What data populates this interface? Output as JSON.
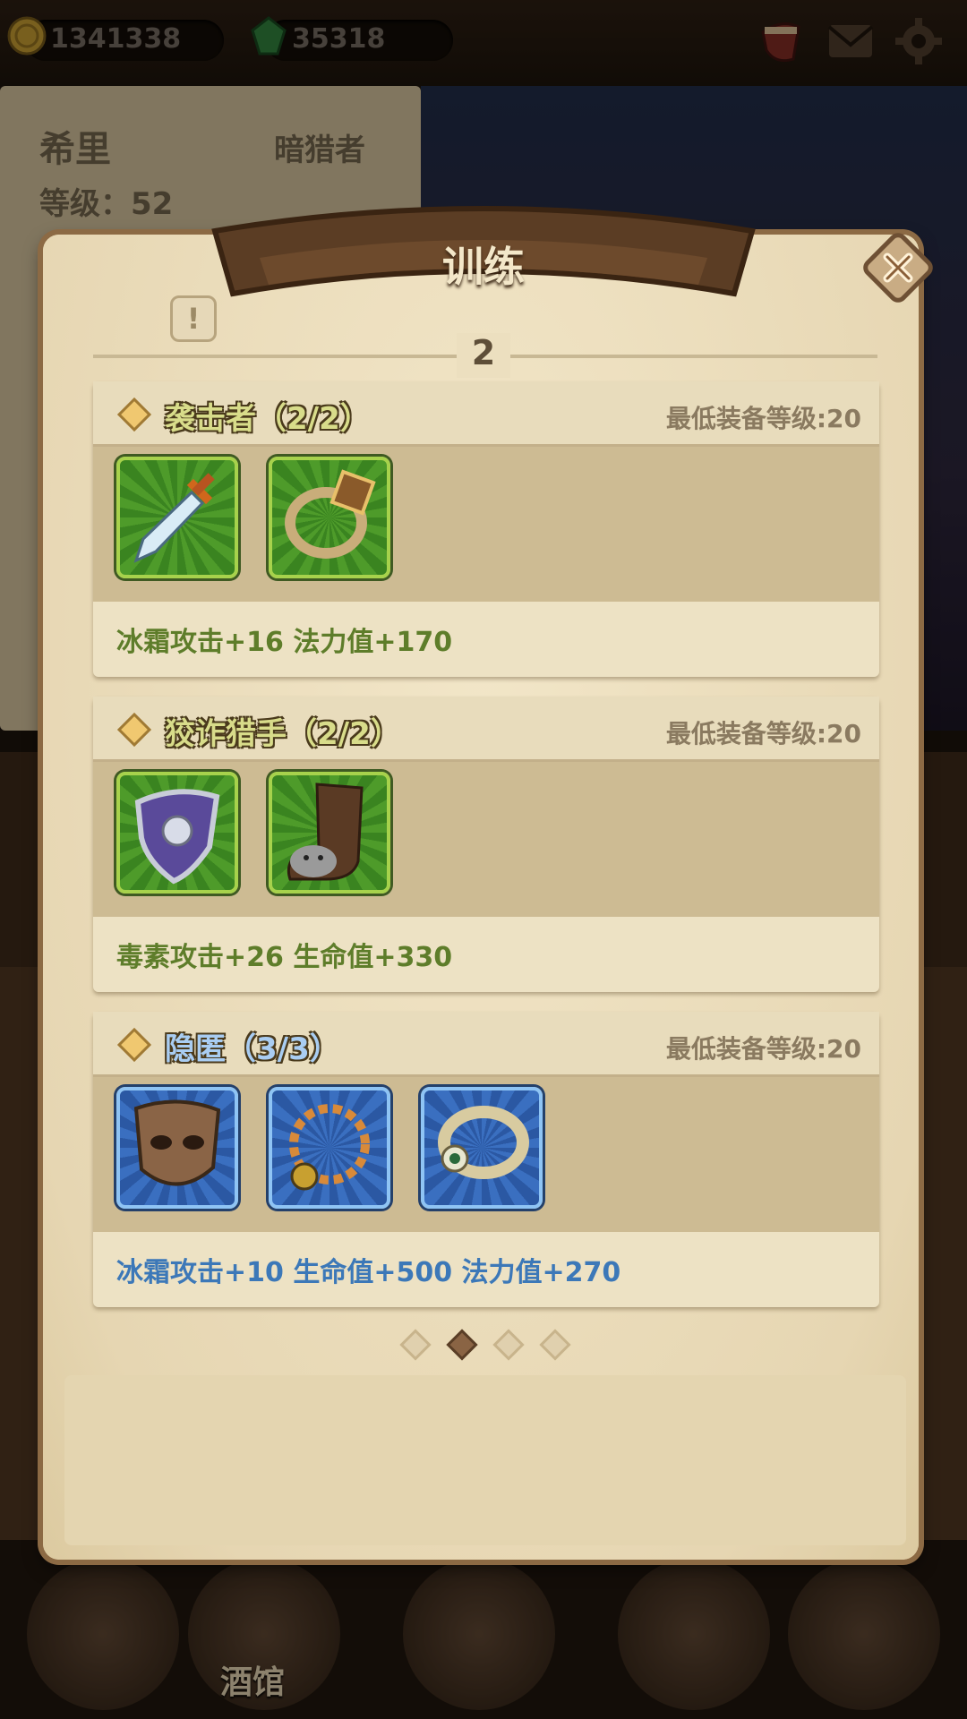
{
  "resources": {
    "gold": "1341338",
    "gems": "35318"
  },
  "hero": {
    "name": "希里",
    "class": "暗猎者",
    "level_text": "等级：52"
  },
  "bottom_nav": {
    "tavern_label": "酒馆"
  },
  "modal": {
    "title": "训练",
    "page_number": "2",
    "pager": {
      "total": 4,
      "active_index": 1
    },
    "sets": [
      {
        "name": "袭击者（2/2）",
        "requirement": "最低装备等级:20",
        "bonus": "冰霜攻击+16  法力值+170",
        "name_color": "#d8dc8a",
        "bonus_color": "#5e7d2a",
        "rarity": "green",
        "items": [
          "dagger-icon",
          "ring-icon"
        ]
      },
      {
        "name": "狡诈猎手（2/2）",
        "requirement": "最低装备等级:20",
        "bonus": "毒素攻击+26  生命值+330",
        "name_color": "#d8dc8a",
        "bonus_color": "#5e7d2a",
        "rarity": "green",
        "items": [
          "shield-icon",
          "boots-icon"
        ]
      },
      {
        "name": "隐匿（3/3）",
        "requirement": "最低装备等级:20",
        "bonus": "冰霜攻击+10  生命值+500  法力值+270",
        "name_color": "#a9cdf2",
        "bonus_color": "#3c78b8",
        "rarity": "blue",
        "items": [
          "mask-icon",
          "necklace-icon",
          "eye-ring-icon"
        ]
      }
    ]
  }
}
